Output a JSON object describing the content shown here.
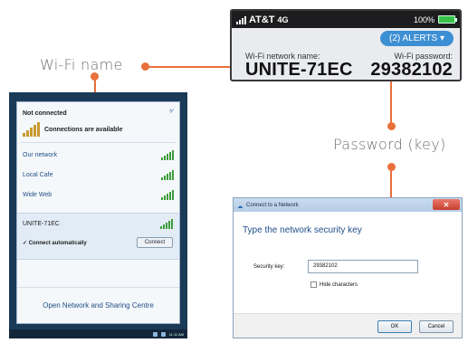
{
  "callouts": {
    "wifi_name": "Wi-Fi name",
    "password": "Password (key)"
  },
  "device": {
    "carrier": "AT&T",
    "network_type": "4G",
    "battery_percent": "100%",
    "alerts_button": "(2) ALERTS",
    "wifi_name_label": "Wi-Fi network name:",
    "wifi_name_value": "UNITE-71EC",
    "wifi_password_label": "Wi-Fi password:",
    "wifi_password_value": "29382102"
  },
  "network_flyout": {
    "status": "Not connected",
    "connections_label": "Connections are available",
    "networks": [
      {
        "name": "Our network"
      },
      {
        "name": "Local Cafe"
      },
      {
        "name": "Wide Web"
      }
    ],
    "selected_network": {
      "name": "UNITE-71EC",
      "auto_connect_label": "Connect automatically",
      "auto_connect_checked": true,
      "connect_button": "Connect"
    },
    "footer_link": "Open Network and Sharing Centre",
    "taskbar_time": "11:11 AM"
  },
  "connect_dialog": {
    "title": "Connect to a Network",
    "close_glyph": "✕",
    "heading": "Type the network security key",
    "security_key_label": "Security key:",
    "security_key_value": "29382102",
    "hide_characters_label": "Hide characters",
    "hide_characters_checked": false,
    "ok_button": "OK",
    "cancel_button": "Cancel"
  },
  "colors": {
    "accent_orange": "#e8703a",
    "alerts_blue": "#3d8fd3",
    "battery_green": "#38c24b",
    "link_blue": "#1f4e84"
  }
}
